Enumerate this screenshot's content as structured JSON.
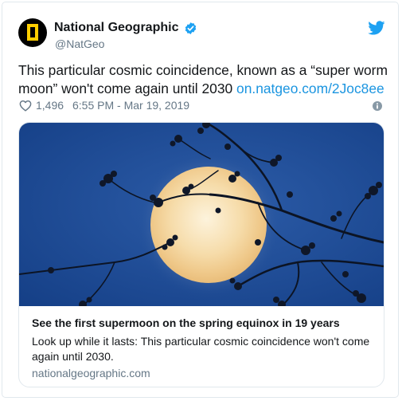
{
  "author": {
    "display_name": "National Geographic",
    "handle": "@NatGeo",
    "verified": true,
    "avatar_icon": "natgeo-yellow-frame-logo",
    "avatar_colors": {
      "background": "#000000",
      "frame": "#ffce00"
    }
  },
  "tweet": {
    "text": "This particular cosmic coincidence, known as a “super worm moon” won't come again until 2030",
    "link_text": "on.natgeo.com/2Joc8ee",
    "likes": "1,496",
    "timestamp": "6:55 PM - Mar 19, 2019"
  },
  "card": {
    "image_description_icon": "full-moon-with-blossom-branches",
    "title": "See the first supermoon on the spring equinox in 19 years",
    "description": "Look up while it lasts: This particular cosmic coincidence won't come again until 2030.",
    "domain": "nationalgeographic.com"
  },
  "icons": {
    "brand": "twitter-bird-icon",
    "verified": "verified-badge-icon",
    "like": "heart-icon",
    "info": "info-icon"
  },
  "colors": {
    "link": "#1b95e0",
    "secondary_text": "#657786",
    "border": "#e1e8ed",
    "verified_badge": "#1da1f2"
  }
}
